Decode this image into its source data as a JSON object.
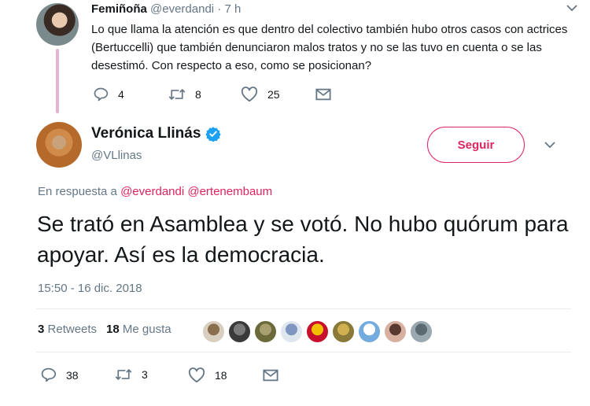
{
  "parent_tweet": {
    "display_name": "Femiñoña",
    "handle": "@everdandi",
    "separator": "·",
    "time": "7 h",
    "text": "Lo que llama la atención es que dentro del colectivo también hubo otros casos con actrices (Bertuccelli) que también denunciaron malos tratos y no se las tuvo en cuenta o se las desestimó. Con respecto a eso, como se posicionan?",
    "actions": {
      "reply_count": "4",
      "retweet_count": "8",
      "like_count": "25"
    }
  },
  "main_tweet": {
    "display_name": "Verónica Llinás",
    "handle": "@VLlinas",
    "follow_label": "Seguir",
    "reply_prefix": "En respuesta a",
    "reply_mentions": [
      "@everdandi",
      "@ertenembaum"
    ],
    "text": "Se trató en Asamblea y se votó. No hubo quórum para apoyar. Así es la democracia.",
    "timestamp": "15:50 - 16 dic. 2018",
    "retweets_count": "3",
    "retweets_label": "Retweets",
    "likes_count": "18",
    "likes_label": "Me gusta",
    "liker_avatars": [
      {
        "colors": [
          "#d9cfc0",
          "#8a6f4e"
        ]
      },
      {
        "colors": [
          "#3a3a3a",
          "#7a7a7a"
        ]
      },
      {
        "colors": [
          "#6b6a3a",
          "#a8a070"
        ]
      },
      {
        "colors": [
          "#dfe6ee",
          "#7f96c0"
        ]
      },
      {
        "colors": [
          "#c8102e",
          "#f0c000"
        ]
      },
      {
        "colors": [
          "#8a7a3a",
          "#d0b050"
        ]
      },
      {
        "colors": [
          "#74acdf",
          "#ffffff"
        ]
      },
      {
        "colors": [
          "#d8b0a0",
          "#5a3a30"
        ]
      },
      {
        "colors": [
          "#9aa8b0",
          "#5a6a70"
        ]
      }
    ],
    "actions": {
      "reply_count": "38",
      "retweet_count": "3",
      "like_count": "18"
    }
  },
  "colors": {
    "accent": "#e0245e",
    "muted": "#657786",
    "verified": "#1da1f2",
    "thread_line": "#e1b4cf"
  }
}
